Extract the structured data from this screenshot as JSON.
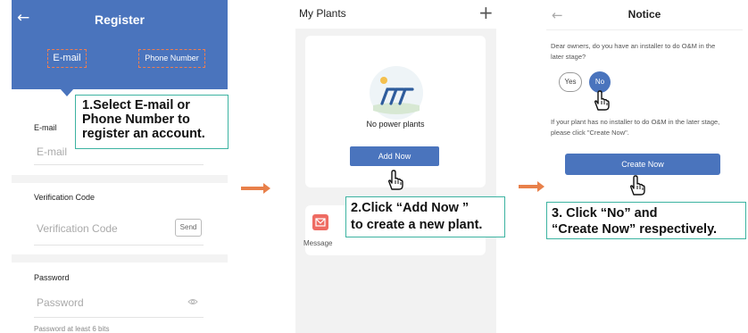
{
  "register": {
    "back_icon": "back-arrow-icon",
    "title": "Register",
    "tab_email": "E-mail",
    "tab_phone": "Phone Number",
    "email_label": "E-mail",
    "email_placeholder": "E-mail",
    "code_label": "Verification Code",
    "code_placeholder": "Verification Code",
    "send_label": "Send",
    "password_label": "Password",
    "password_placeholder": "Password",
    "password_hint": "Password at least 6 bits",
    "accent_color": "#4a74bd"
  },
  "my_plants": {
    "title": "My Plants",
    "add_icon": "+",
    "empty_text": "No power plants",
    "add_now_label": "Add Now",
    "message_label": "Message"
  },
  "notice": {
    "back_icon": "back-arrow-icon",
    "title": "Notice",
    "question": "Dear owners, do you have an installer to do O&M in the later stage?",
    "yes_label": "Yes",
    "no_label": "No",
    "info": "If your plant has no installer to do O&M in the later stage, please click \"Create Now\".",
    "create_now_label": "Create Now"
  },
  "callouts": {
    "step1": "1.Select E-mail or\nPhone Number to\nregister an account.",
    "step2": "2.Click “Add Now ”\nto create a new plant.",
    "step3": "3. Click “No” and\n“Create Now” respectively."
  },
  "colors": {
    "primary_blue": "#4a74bd",
    "callout_border": "#3cb3a1",
    "arrow_orange": "#e8804a",
    "dashed_orange": "#f07d4e",
    "message_red": "#ee6b62"
  }
}
